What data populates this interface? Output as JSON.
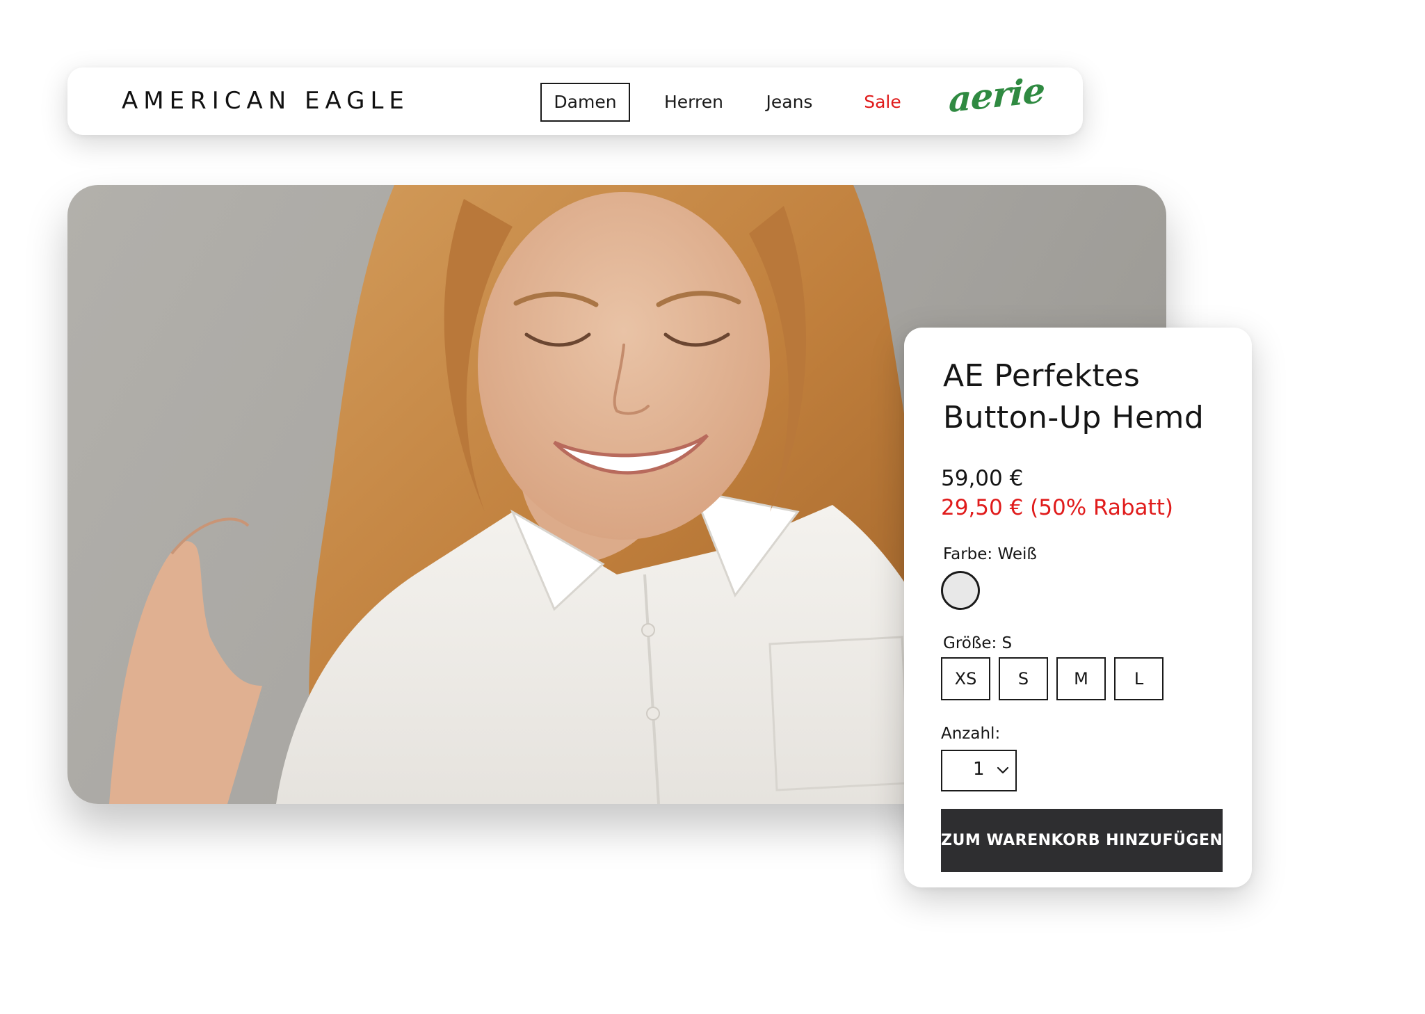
{
  "header": {
    "brand": "AMERICAN EAGLE",
    "nav": [
      {
        "label": "Damen",
        "active": true
      },
      {
        "label": "Herren"
      },
      {
        "label": "Jeans"
      },
      {
        "label": "Sale",
        "color": "#e01b1b"
      }
    ],
    "sub_brand": "aerie",
    "sub_brand_color": "#2f8a41"
  },
  "product": {
    "title_line1": "AE Perfektes",
    "title_line2": "Button-Up Hemd",
    "price_original": "59,00 €",
    "price_sale": "29,50 € (50% Rabatt)",
    "sale_color": "#e01b1b",
    "color_label": "Farbe: Weiß",
    "color_swatch": "#e8e8e8",
    "size_label": "Größe: S",
    "sizes": [
      "XS",
      "S",
      "M",
      "L"
    ],
    "selected_size": "S",
    "quantity_label": "Anzahl:",
    "quantity_value": "1",
    "add_to_cart": "ZUM WARENKORB HINZUFÜGEN",
    "button_color": "#2e2e30"
  }
}
